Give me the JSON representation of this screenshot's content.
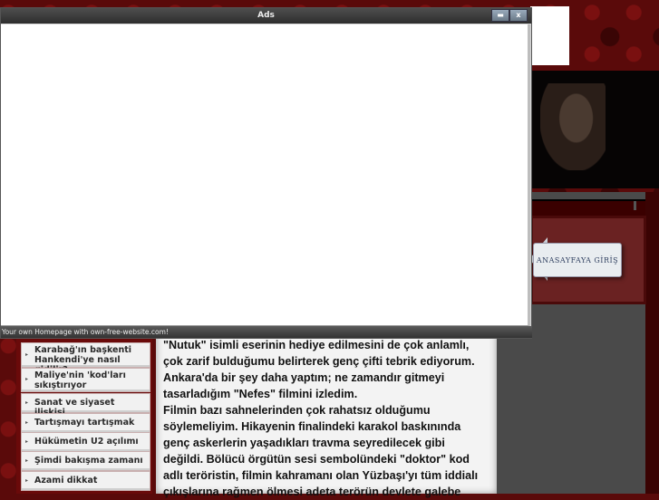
{
  "ads_window": {
    "title": "Ads",
    "footer": "Your own Homepage with own-free-website.com!",
    "minimize_icon": "minimize-icon",
    "close_glyph": "x"
  },
  "side": {
    "anasayfa_label": "ANASAYFAYA GİRİŞ"
  },
  "menu": {
    "items": [
      "Karabağ'ın başkenti Hankendi'ye nasıl gidilir?",
      "Maliye'nin 'kod'ları sıkıştırıyor",
      "Sanat ve siyaset ilişkisi",
      "Tartışmayı tartışmak",
      "Hükümetin U2 açılımı",
      "Şimdi bakışma zamanı",
      "Azami dikkat"
    ]
  },
  "article": {
    "text": "\"Nutuk\" isimli eserinin hediye edilmesini de çok anlamlı, çok zarif bulduğumu belirterek genç çifti tebrik ediyorum. Ankara'da bir şey daha yaptım; ne zamandır gitmeyi tasarladığım \"Nefes\" filmini izledim.\nFilmin bazı sahnelerinden çok rahatsız olduğumu söylemeliyim. Hikayenin finalindeki karakol baskınında genç askerlerin yaşadıkları travma seyredilecek gibi değildi. Bölücü örgütün sesi sembolündeki \"doktor\" kod adlı teröristin, filmin kahramanı olan Yüzbaşı'yı tüm iddialı çıkışlarına rağmen ölmesi adeta terörün devlete galebe"
  },
  "colors": {
    "background": "#5a0a0a",
    "ads_title_bar": "#3a3a3a",
    "menu_item_bg": "#f1f1f1"
  }
}
